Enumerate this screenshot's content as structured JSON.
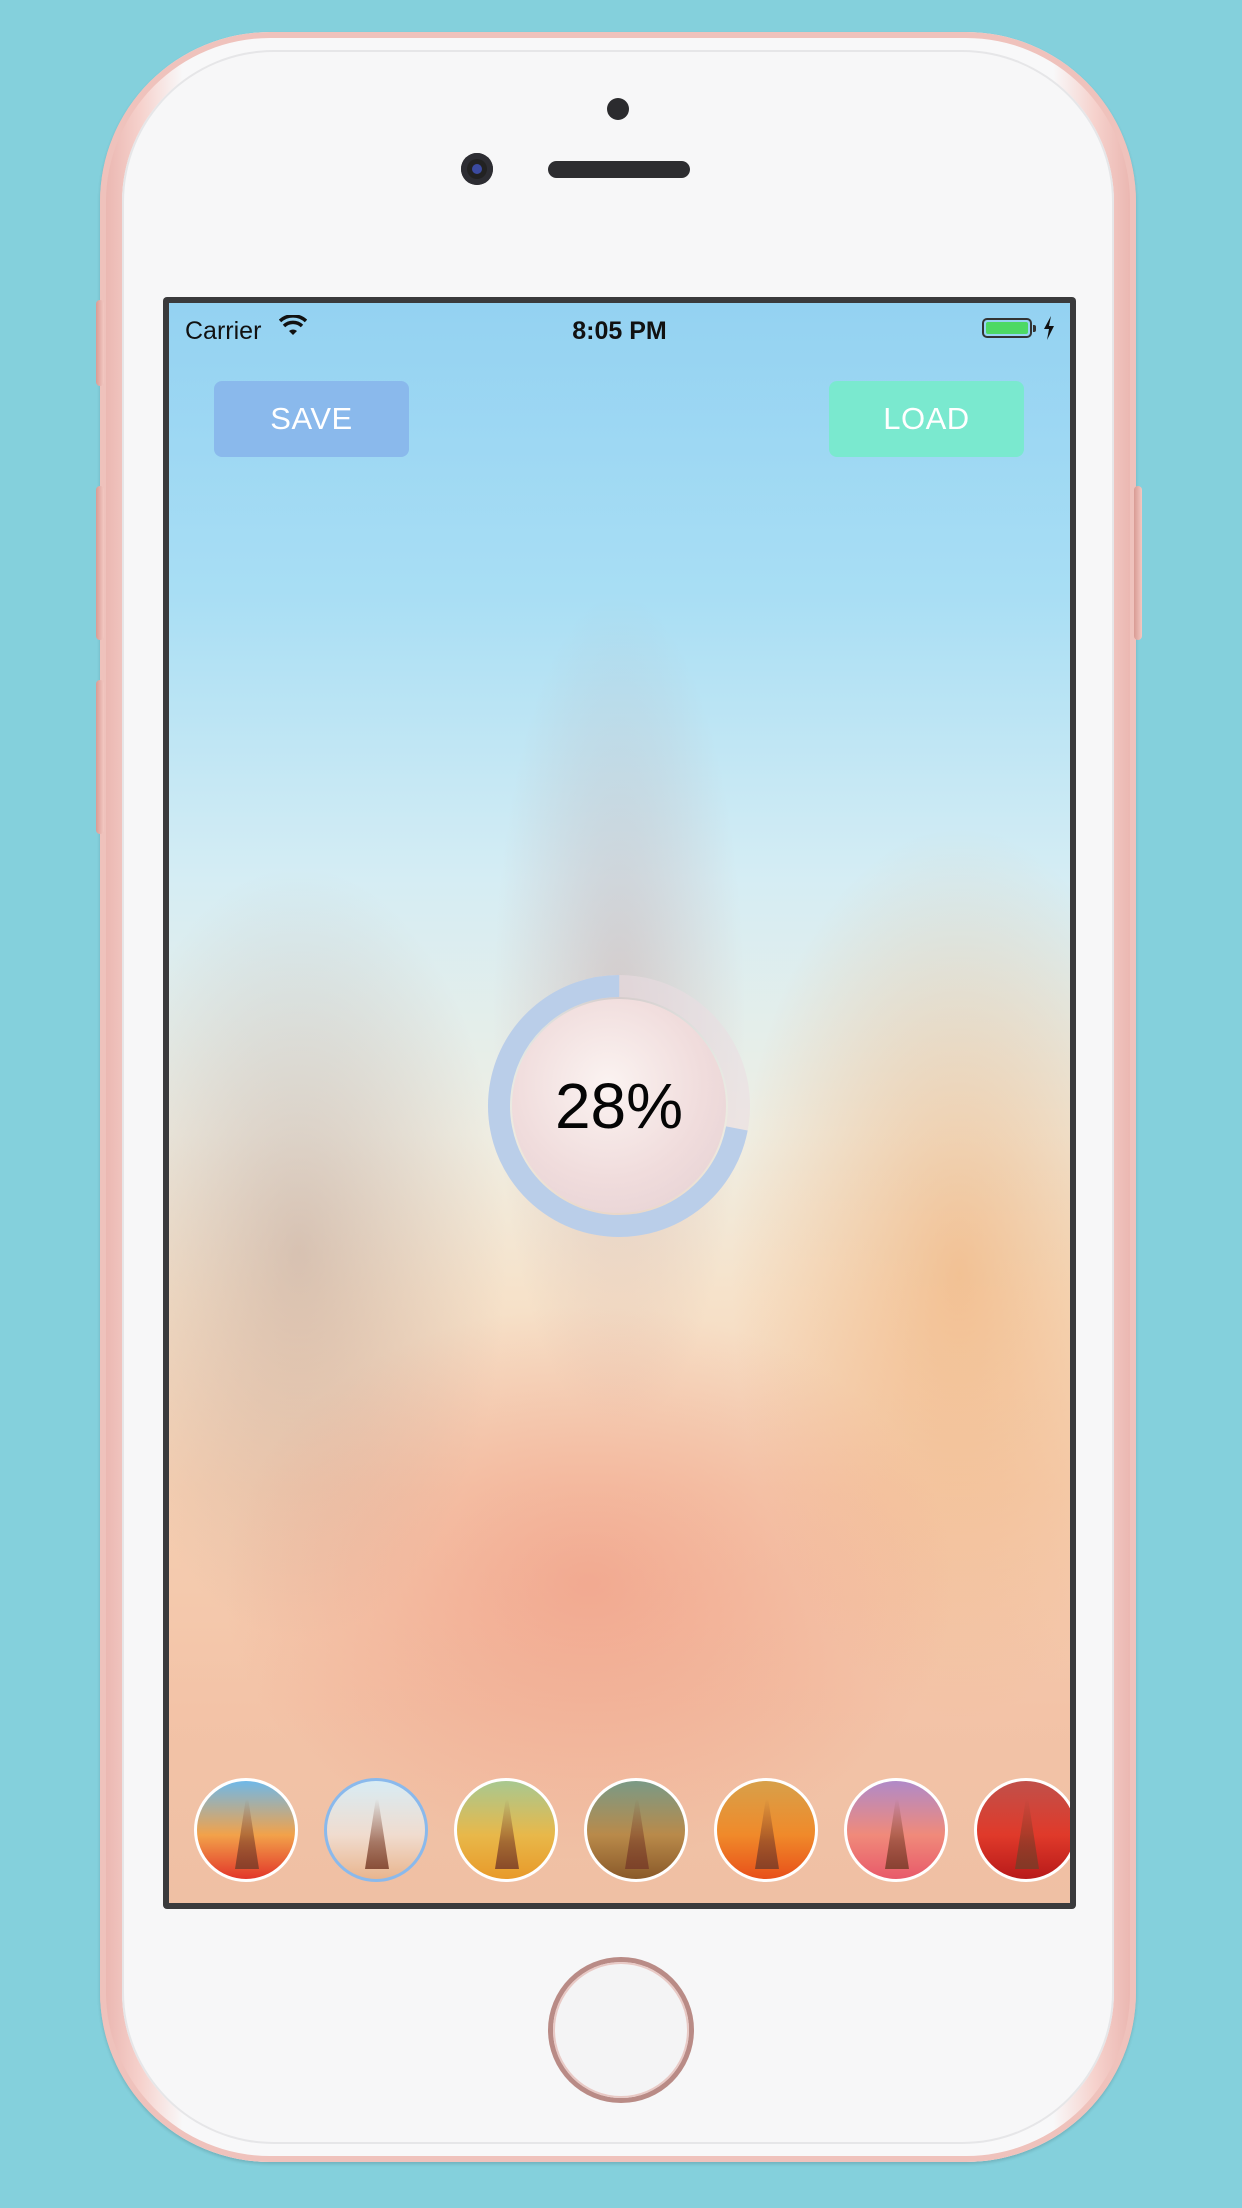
{
  "status_bar": {
    "carrier": "Carrier",
    "time": "8:05 PM",
    "battery_level": 1.0
  },
  "buttons": {
    "save_label": "SAVE",
    "load_label": "LOAD",
    "save_color": "#8ab9ec",
    "load_color": "#7ae9cf"
  },
  "progress": {
    "value": 0.28,
    "label": "28%"
  },
  "filters": [
    {
      "name": "filter-1",
      "colors": [
        "#6fb8e8",
        "#f2a24a",
        "#e2362a"
      ]
    },
    {
      "name": "filter-2",
      "colors": [
        "#d8ecf4",
        "#f0dccf",
        "#e9b58e"
      ],
      "selected": true
    },
    {
      "name": "filter-3",
      "colors": [
        "#a8c890",
        "#e8b84a",
        "#e89a2a"
      ]
    },
    {
      "name": "filter-4",
      "colors": [
        "#7a9a86",
        "#b98a4a",
        "#8a5a2a"
      ]
    },
    {
      "name": "filter-5",
      "colors": [
        "#d7a04a",
        "#f08a2a",
        "#e8501a"
      ]
    },
    {
      "name": "filter-6",
      "colors": [
        "#b08ac8",
        "#f08a7a",
        "#e85a6a"
      ]
    },
    {
      "name": "filter-7",
      "colors": [
        "#c0504a",
        "#e03a2a",
        "#b81a1a"
      ]
    }
  ]
}
